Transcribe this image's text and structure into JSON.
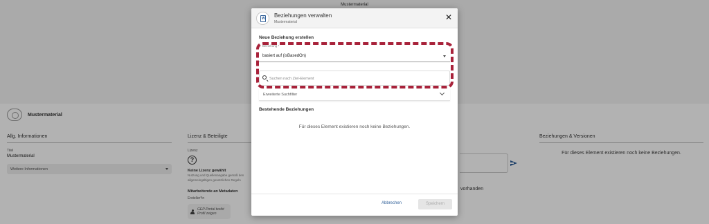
{
  "background": {
    "top_title": "Mustermaterial",
    "header_title": "Mustermaterial",
    "col1": {
      "title": "Allg. Informationen",
      "field_label": "Titel",
      "field_value": "Mustermaterial",
      "more_label": "Weitere Informationen"
    },
    "col2": {
      "title": "Lizenz & Beteiligte",
      "license_label": "Lizenz",
      "license_head": "Keine Lizenz gewählt",
      "license_text_1": "Nutzung und Quellenangabe gemäß den",
      "license_text_2": "allgemeingültigen gesetzlichen Regeln",
      "contributors_head": "Mitarbeitende an Metadaten",
      "role": "Ersteller*in",
      "profile_line1": "GEP-Portal testkt",
      "profile_line2": "Profil zeigen"
    },
    "col3": {
      "status_text": "vorhanden"
    },
    "col4": {
      "title": "Beziehungen & Versionen",
      "empty_message": "Für dieses Element existieren noch keine Beziehungen."
    }
  },
  "dialog": {
    "title": "Beziehungen verwalten",
    "subtitle": "Mustermaterial",
    "close_symbol": "✕",
    "new_section_title": "Neue Beziehung erstellen",
    "relation_field_label": "Beziehung *",
    "relation_value": "basiert auf (isBasedOn)",
    "search_placeholder": "Suchen nach Ziel-Element",
    "advanced_filter_label": "Erweiterte Suchfilter",
    "existing_section_title": "Bestehende Beziehungen",
    "empty_message": "Für dieses Element existieren noch keine Beziehungen.",
    "cancel_label": "Abbrechen",
    "save_label": "Speichern",
    "highlight_color": "#a8223a",
    "accent_color": "#2f5f98"
  }
}
